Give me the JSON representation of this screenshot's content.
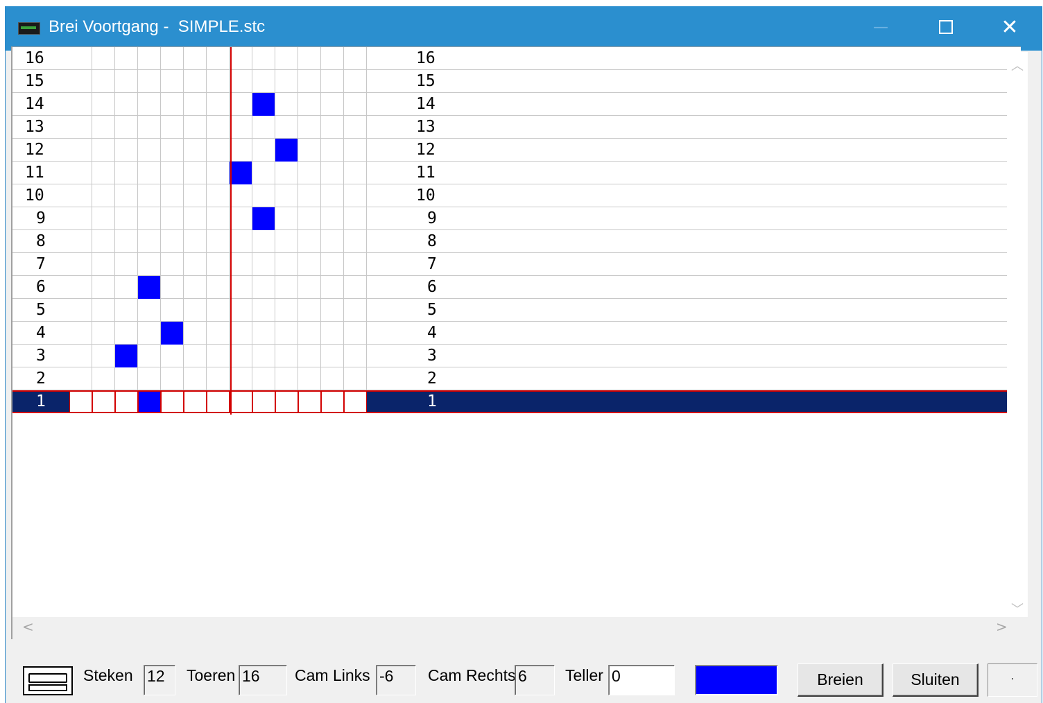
{
  "window": {
    "title": "Brei Voortgang -  SIMPLE.stc",
    "minimize_glyph": "—",
    "close_glyph": "✕"
  },
  "grid": {
    "rows": [
      16,
      15,
      14,
      13,
      12,
      11,
      10,
      9,
      8,
      7,
      6,
      5,
      4,
      3,
      2,
      1
    ],
    "columns": 13,
    "current_row": 1,
    "filled_cells": {
      "14": [
        9
      ],
      "12": [
        10
      ],
      "11": [
        8
      ],
      "9": [
        9
      ],
      "6": [
        4
      ],
      "4": [
        5
      ],
      "3": [
        3
      ],
      "1": [
        4
      ]
    },
    "cell_fill_color": "#0000ff",
    "highlight_color": "#0a246a",
    "marker_color": "#d20000"
  },
  "scrollbars": {
    "up_glyph": "︿",
    "down_glyph": "﹀",
    "left_glyph": "<",
    "right_glyph": ">"
  },
  "status": {
    "steken_label": "Steken",
    "steken_value": "12",
    "toeren_label": "Toeren",
    "toeren_value": "16",
    "cam_links_label": "Cam Links",
    "cam_links_value": "-6",
    "cam_rechts_label": "Cam Rechts",
    "cam_rechts_value": "6",
    "teller_label": "Teller",
    "teller_value": "0",
    "color_value": "#0000ff",
    "breien_label": "Breien",
    "sluiten_label": "Sluiten",
    "last_panel_text": "·"
  }
}
